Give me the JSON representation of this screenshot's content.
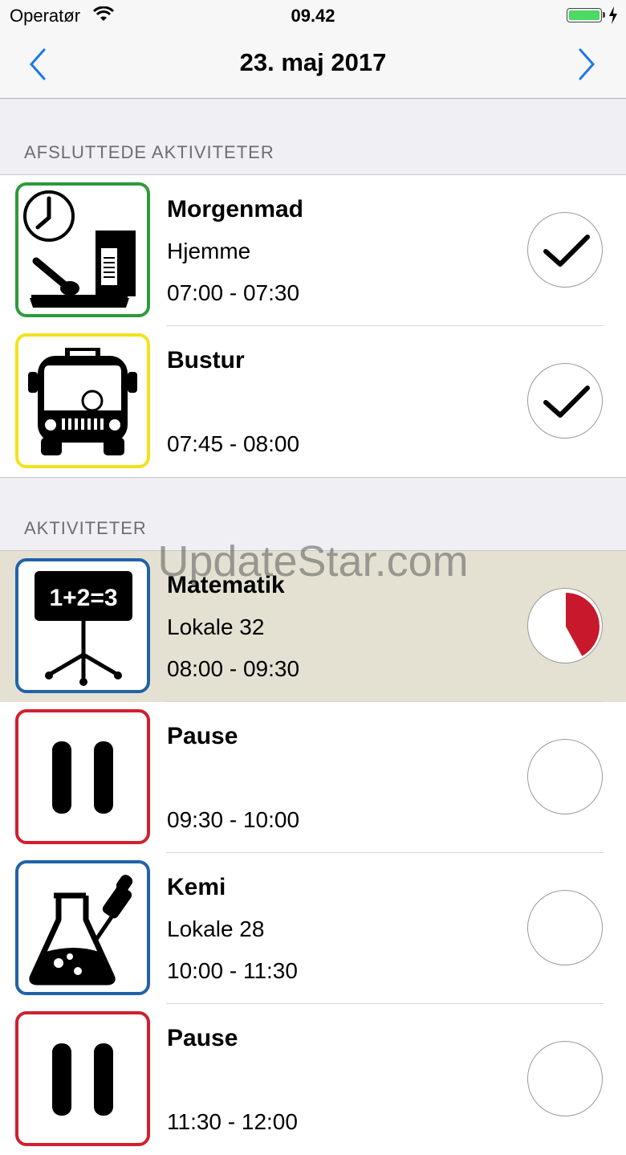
{
  "status_bar": {
    "carrier": "Operatør",
    "time": "09.42",
    "battery_color": "#4cd964"
  },
  "nav": {
    "title": "23. maj 2017",
    "back_icon": "chevron-left-icon",
    "forward_icon": "chevron-right-icon",
    "tint": "#1a78e8"
  },
  "sections": {
    "completed": {
      "header": "AFSLUTTEDE AKTIVITETER",
      "items": [
        {
          "title": "Morgenmad",
          "place": "Hjemme",
          "time": "07:00 - 07:30",
          "icon": "breakfast-icon",
          "frame_color": "#2e9a3a",
          "status": "done"
        },
        {
          "title": "Bustur",
          "place": "",
          "time": "07:45 - 08:00",
          "icon": "bus-icon",
          "frame_color": "#f2e21b",
          "status": "done"
        }
      ]
    },
    "activities": {
      "header": "AKTIVITETER",
      "items": [
        {
          "title": "Matematik",
          "place": "Lokale 32",
          "time": "08:00 - 09:30",
          "icon": "blackboard-math-icon",
          "board_text": "1+2=3",
          "frame_color": "#2162a8",
          "status": "in-progress",
          "progress": 0.42
        },
        {
          "title": "Pause",
          "place": "",
          "time": "09:30 - 10:00",
          "icon": "pause-icon",
          "frame_color": "#d0202f",
          "status": "pending"
        },
        {
          "title": "Kemi",
          "place": "Lokale 28",
          "time": "10:00 - 11:30",
          "icon": "chemistry-flask-icon",
          "frame_color": "#2162a8",
          "status": "pending"
        },
        {
          "title": "Pause",
          "place": "",
          "time": "11:30 - 12:00",
          "icon": "pause-icon",
          "frame_color": "#d0202f",
          "status": "pending"
        }
      ]
    }
  },
  "watermark": "UpdateStar.com",
  "colors": {
    "progress_red": "#c8182b"
  }
}
